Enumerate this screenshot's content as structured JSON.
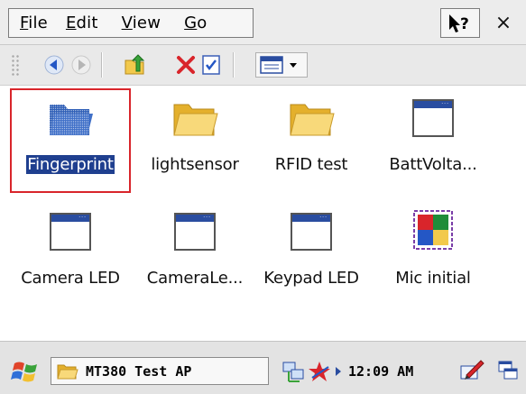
{
  "menu": {
    "items": [
      {
        "first": "F",
        "rest": "ile"
      },
      {
        "first": "E",
        "rest": "dit"
      },
      {
        "first": "V",
        "rest": "iew"
      },
      {
        "first": "G",
        "rest": "o"
      }
    ],
    "help_label": "?",
    "close_label": "×"
  },
  "toolbar": {
    "buttons": [
      "back-icon",
      "forward-icon",
      "up-folder-icon",
      "delete-icon",
      "properties-icon",
      "view-menu-icon"
    ]
  },
  "items": [
    {
      "label": "Fingerprint",
      "icon": "folder-icon",
      "selected": true
    },
    {
      "label": "lightsensor",
      "icon": "folder-icon"
    },
    {
      "label": "RFID test",
      "icon": "folder-icon"
    },
    {
      "label": "BattVolta...",
      "icon": "app-window-icon"
    },
    {
      "label": "Camera LED",
      "icon": "app-window-icon"
    },
    {
      "label": "CameraLe...",
      "icon": "app-window-icon"
    },
    {
      "label": "Keypad LED",
      "icon": "app-window-icon"
    },
    {
      "label": "Mic initial",
      "icon": "mwce-icon"
    }
  ],
  "taskbar": {
    "task_label": "MT380 Test AP",
    "clock": "12:09 AM"
  },
  "colors": {
    "selection": "#1f3f8f",
    "highlight_box": "#d9252b",
    "folder": "#f2c94c",
    "window_titlebar": "#2a4da0"
  }
}
